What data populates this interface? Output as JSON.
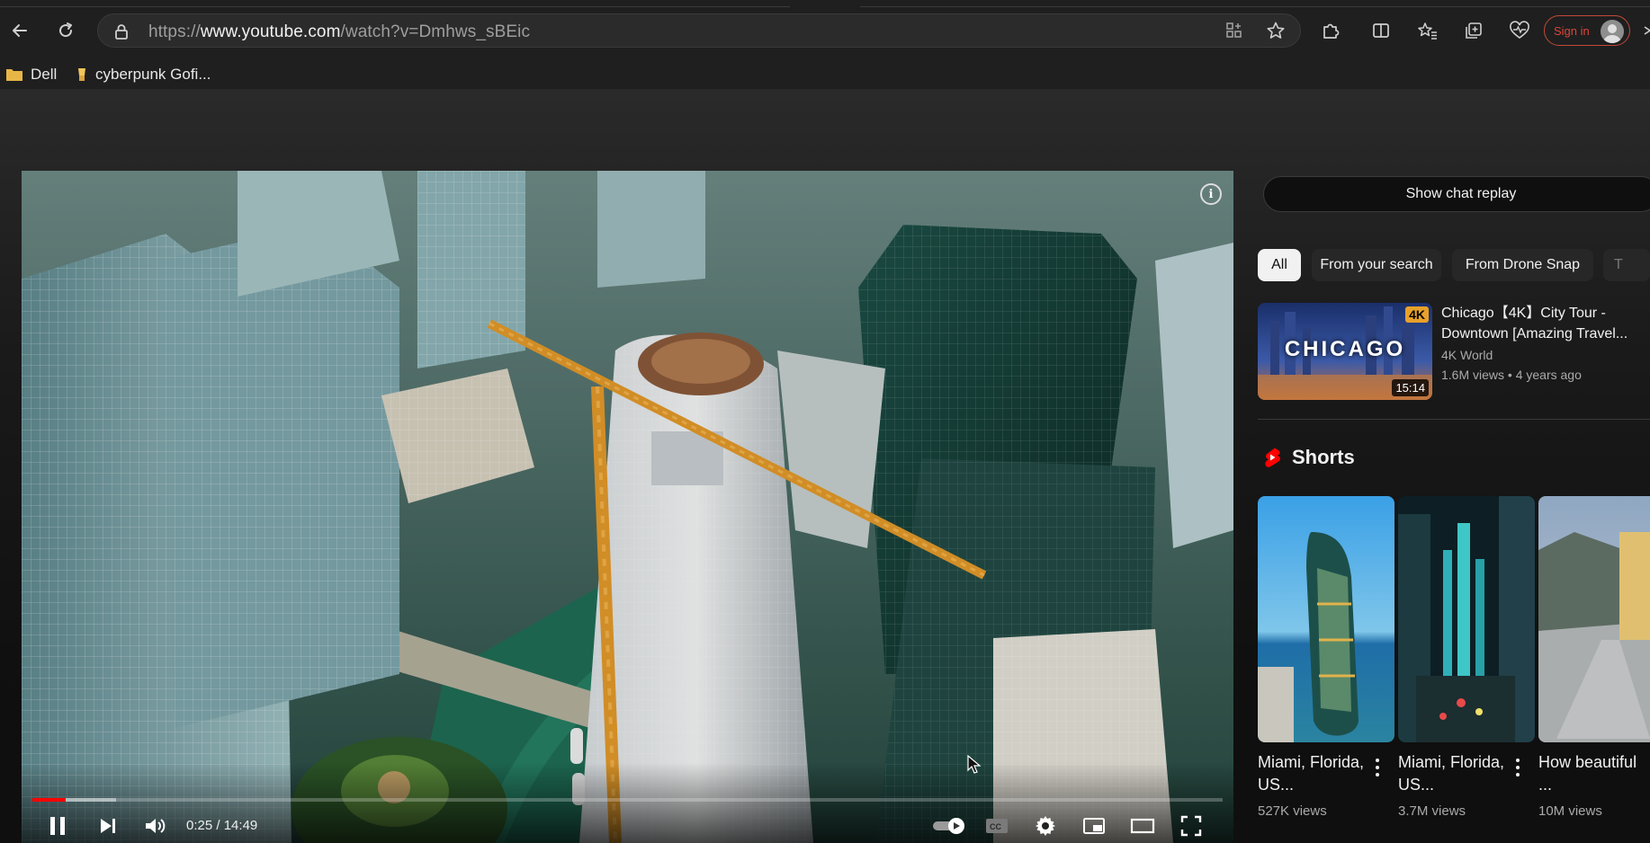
{
  "browser": {
    "url_prefix": "https://",
    "url_host": "www.youtube.com",
    "url_path": "/watch?v=Dmhws_sBEic",
    "signin_label": "Sign in",
    "bookmarks": [
      {
        "label": "Dell",
        "icon": "folder-icon"
      },
      {
        "label": "cyberpunk Gofi...",
        "icon": "favicon"
      }
    ]
  },
  "player": {
    "current_time": "0:25",
    "time_separator": " / ",
    "duration": "14:49",
    "progress_fraction": 0.028,
    "buffered_fraction": 0.07,
    "info_label": "i"
  },
  "sidebar": {
    "chat_replay_label": "Show chat replay",
    "chips": [
      {
        "label": "All",
        "active": true
      },
      {
        "label": "From your search",
        "active": false
      },
      {
        "label": "From Drone Snap",
        "active": false
      },
      {
        "label": "T",
        "active": false
      }
    ],
    "recommendation": {
      "thumb_text": "CHICAGO",
      "badge": "4K",
      "duration": "15:14",
      "title": "Chicago【4K】City Tour - Downtown [Amazing Travel...",
      "channel": "4K World",
      "views": "1.6M views",
      "age": "4 years ago",
      "separator": " • "
    },
    "shorts_title": "Shorts",
    "shorts": [
      {
        "title": "Miami, Florida, US...",
        "views": "527K views"
      },
      {
        "title": "Miami, Florida, US...",
        "views": "3.7M views"
      },
      {
        "title": "How beautiful ...",
        "views": "10M views"
      }
    ]
  },
  "colors": {
    "accent_red": "#ff0000",
    "chip_active_bg": "#f1f1f1",
    "badge_4k": "#e8a12a"
  }
}
